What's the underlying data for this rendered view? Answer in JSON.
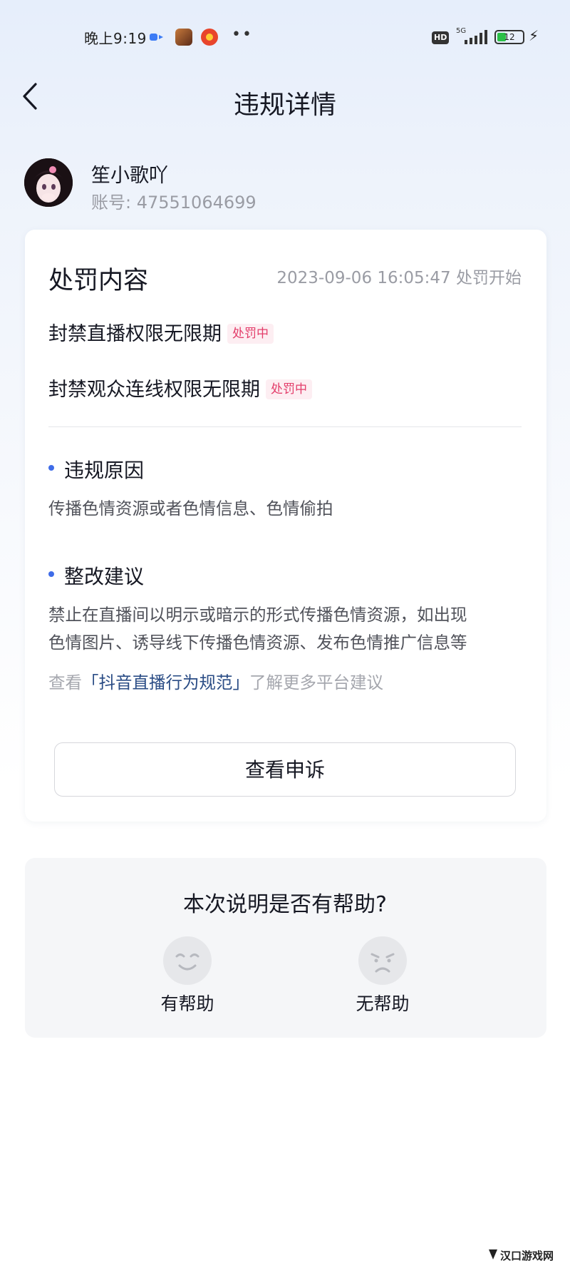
{
  "status_bar": {
    "time": "晚上9:19",
    "more_indicator": "••",
    "hd_label": "HD",
    "network_label": "5G",
    "battery_level": "12"
  },
  "nav": {
    "title": "违规详情"
  },
  "profile": {
    "name": "笙小歌吖",
    "account": "账号: 47551064699"
  },
  "penalty": {
    "section_title": "处罚内容",
    "start_time": "2023-09-06 16:05:47 处罚开始",
    "items": [
      {
        "label": "封禁直播权限无限期",
        "status": "处罚中"
      },
      {
        "label": "封禁观众连线权限无限期",
        "status": "处罚中"
      }
    ],
    "reason_title": "违规原因",
    "reason_text": "传播色情资源或者色情信息、色情偷拍",
    "advice_title": "整改建议",
    "advice_line1": "禁止在直播间以明示或暗示的形式传播色情资源，如出现",
    "advice_line2": "色情图片、诱导线下传播色情资源、发布色情推广信息等",
    "hint_prefix": "查看",
    "hint_link": "「抖音直播行为规范」",
    "hint_suffix": "了解更多平台建议",
    "appeal_button": "查看申诉"
  },
  "feedback": {
    "question": "本次说明是否有帮助?",
    "helpful_label": "有帮助",
    "unhelpful_label": "无帮助"
  },
  "watermark": {
    "text": "汉口游戏网"
  },
  "colors": {
    "accent_blue": "#3f6ce8",
    "tag_red": "#e33d6a",
    "link": "#2a4c85"
  }
}
